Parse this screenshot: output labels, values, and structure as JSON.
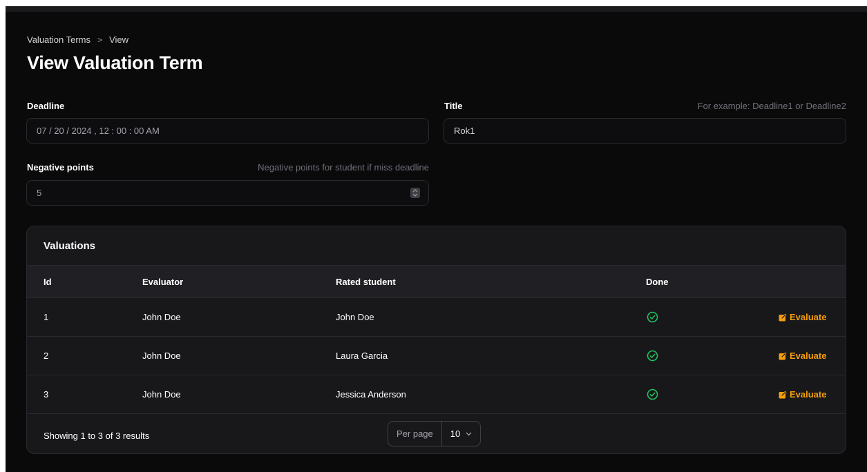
{
  "breadcrumb": {
    "parent": "Valuation Terms",
    "separator": ">",
    "current": "View"
  },
  "page": {
    "title": "View Valuation Term"
  },
  "form": {
    "deadline": {
      "label": "Deadline",
      "value": "07 / 20 / 2024 ,  12 : 00 : 00   AM"
    },
    "title": {
      "label": "Title",
      "hint": "For example: Deadline1 or Deadline2",
      "value": "Rok1"
    },
    "negative_points": {
      "label": "Negative points",
      "hint": "Negative points for student if miss deadline",
      "value": "5"
    }
  },
  "valuations": {
    "title": "Valuations",
    "columns": [
      "Id",
      "Evaluator",
      "Rated student",
      "Done"
    ],
    "rows": [
      {
        "id": "1",
        "evaluator": "John Doe",
        "student": "John Doe",
        "done": true,
        "action": "Evaluate"
      },
      {
        "id": "2",
        "evaluator": "John Doe",
        "student": "Laura Garcia",
        "done": true,
        "action": "Evaluate"
      },
      {
        "id": "3",
        "evaluator": "John Doe",
        "student": "Jessica Anderson",
        "done": true,
        "action": "Evaluate"
      }
    ],
    "footer": {
      "summary": "Showing 1 to 3 of 3 results",
      "per_page_label": "Per page",
      "per_page_value": "10"
    }
  },
  "colors": {
    "accent": "#f59e0b",
    "success": "#22c55e",
    "background": "#0a0a0b",
    "card": "#18181b"
  },
  "icons": {
    "done": "check-circle-icon",
    "evaluate": "edit-square-icon",
    "per_page": "chevron-down-icon",
    "stepper": "up-down-icon"
  }
}
